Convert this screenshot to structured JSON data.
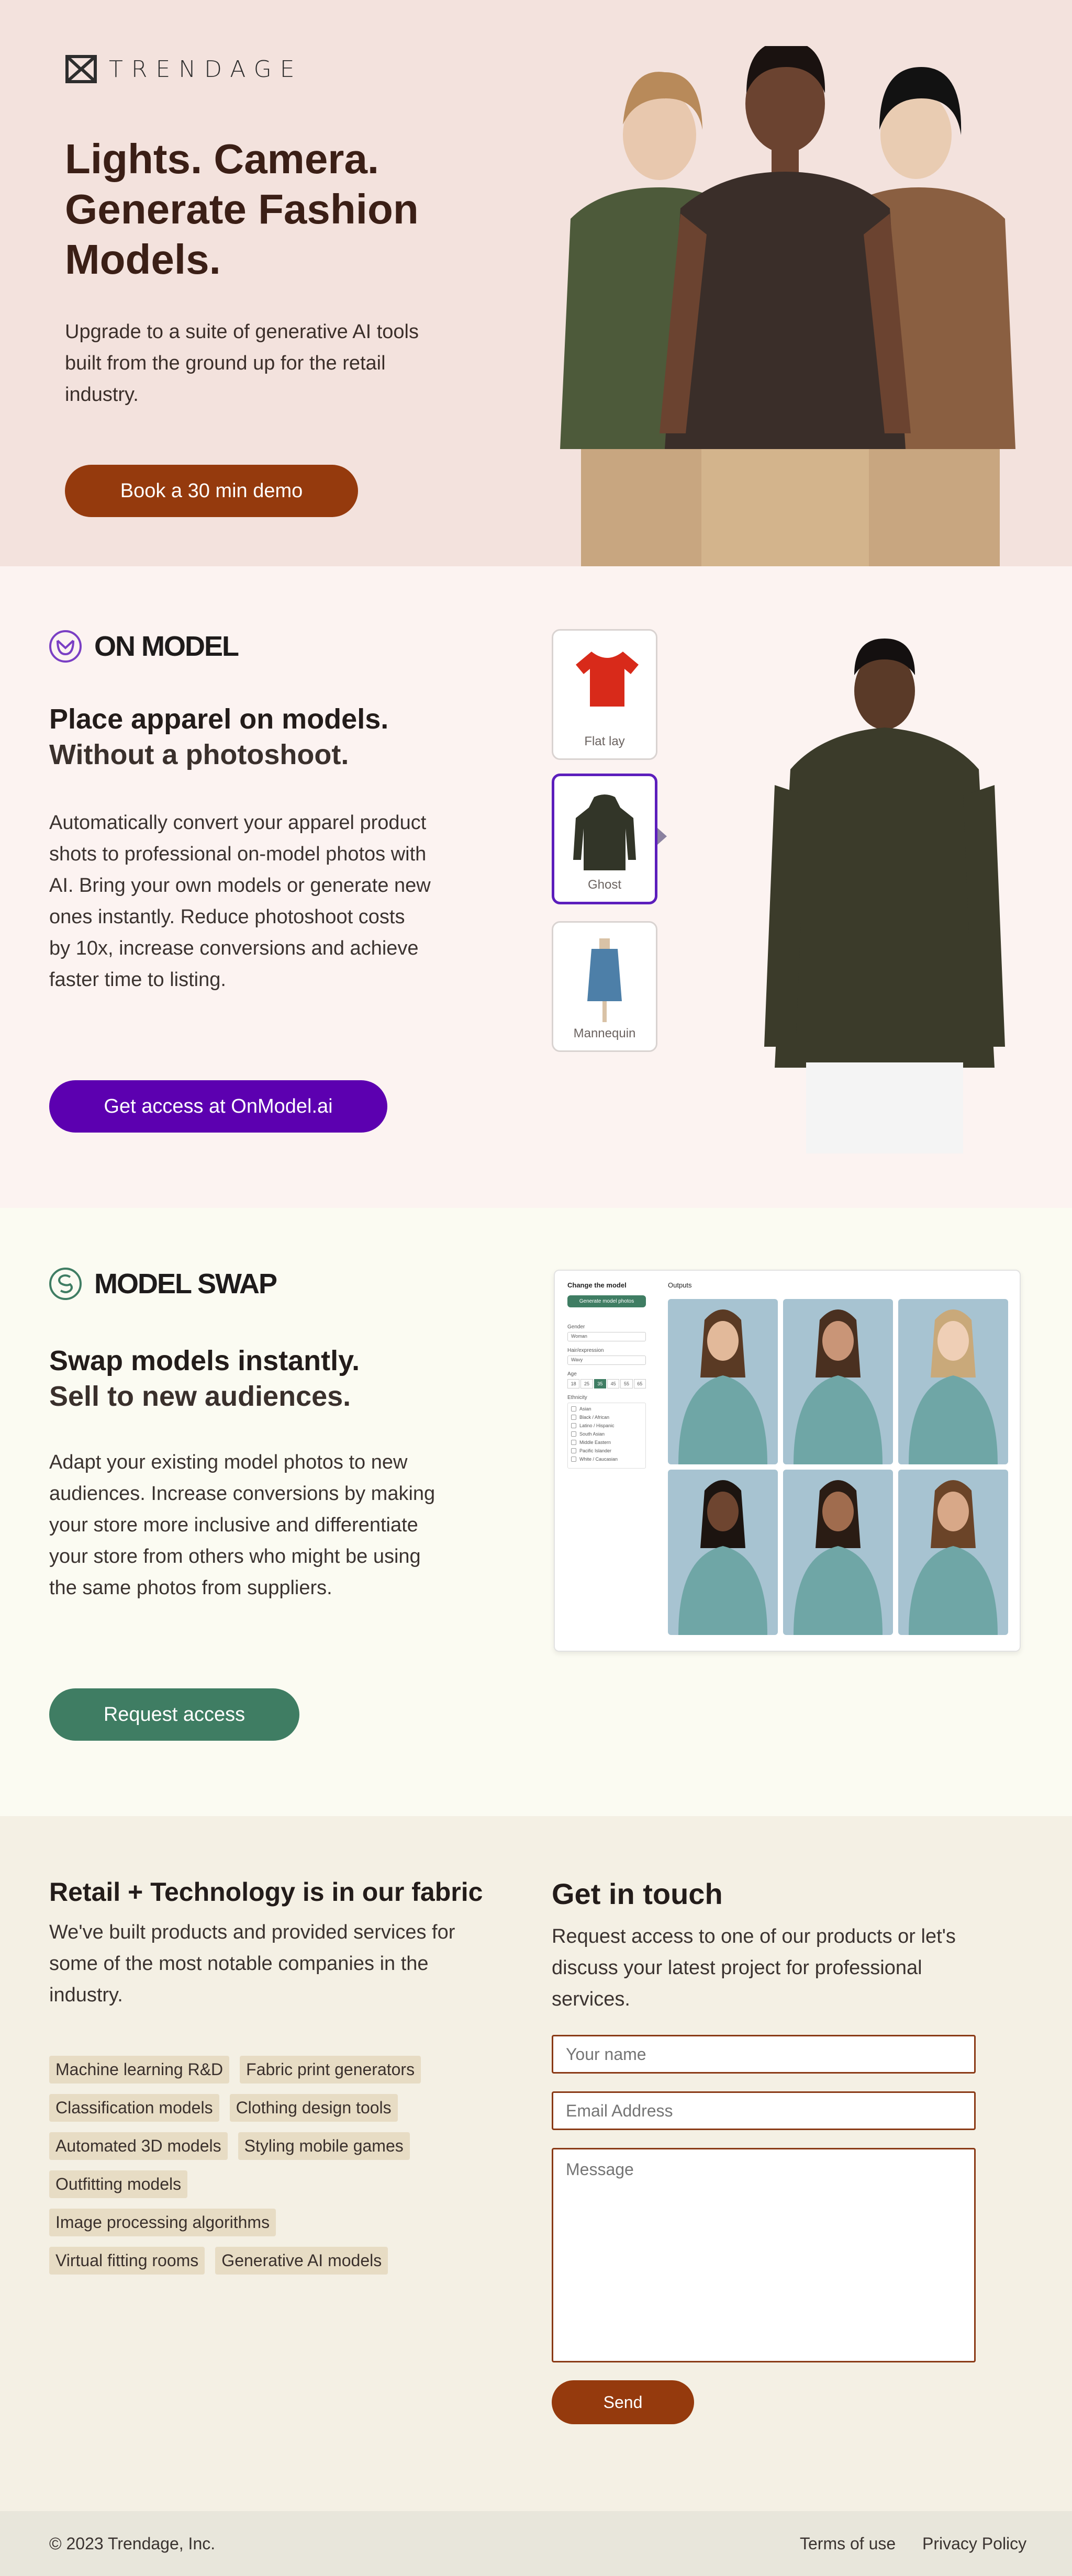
{
  "hero": {
    "logo_text": "TRENDAGE",
    "title": "Lights. Camera. Generate Fashion Models.",
    "subtitle": "Upgrade to a suite of generative AI tools built from the ground up for the retail industry.",
    "cta": "Book a 30 min demo"
  },
  "onmodel": {
    "brand": "ON MODEL",
    "heading": "Place apparel on models.",
    "heading_light": "Without a photoshoot.",
    "body": "Automatically convert your apparel product shots to professional on-model photos with AI. Bring your own models or generate new ones instantly. Reduce photoshoot costs by 10x, increase conversions and achieve faster time to listing.",
    "cta": "Get access at OnModel.ai",
    "thumbs": [
      "Flat lay",
      "Ghost",
      "Mannequin"
    ]
  },
  "swap": {
    "brand": "MODEL SWAP",
    "heading": "Swap models instantly.",
    "heading_light": "Sell to new audiences.",
    "body": "Adapt your existing model photos to new audiences. Increase conversions by making your store more inclusive and differentiate your store from others who might be using the same photos from suppliers.",
    "cta": "Request access",
    "panel": {
      "title": "Change the model",
      "generate": "Generate model photos",
      "gender_label": "Gender",
      "gender_value": "Woman",
      "hair_label": "Hair/expression",
      "hair_value": "Wavy",
      "age_label": "Age",
      "ages": [
        "18",
        "25",
        "35",
        "45",
        "55",
        "65"
      ],
      "ethnicity_label": "Ethnicity",
      "ethnicities": [
        "Asian",
        "Black / African",
        "Latino / Hispanic",
        "South Asian",
        "Middle Eastern",
        "Pacific Islander",
        "White / Caucasian"
      ],
      "outputs": "Outputs"
    }
  },
  "contact": {
    "left_heading": "Retail + Technology is in our fabric",
    "left_body": "We've built products and provided services for some of the most notable companies in the industry.",
    "tags": [
      [
        "Machine learning R&D",
        "Fabric print generators"
      ],
      [
        "Classification models",
        "Clothing design tools"
      ],
      [
        "Automated 3D models",
        "Styling mobile games"
      ],
      [
        "Outfitting models"
      ],
      [
        "Image processing algorithms"
      ],
      [
        "Virtual fitting rooms",
        "Generative AI models"
      ]
    ],
    "right_heading": "Get in touch",
    "right_body": "Request access to one of our products or let's discuss your latest project for professional services.",
    "name_placeholder": "Your name",
    "email_placeholder": "Email Address",
    "message_placeholder": "Message",
    "send": "Send"
  },
  "footer": {
    "copyright": "© 2023 Trendage, Inc.",
    "terms": "Terms of use",
    "privacy": "Privacy Policy"
  }
}
